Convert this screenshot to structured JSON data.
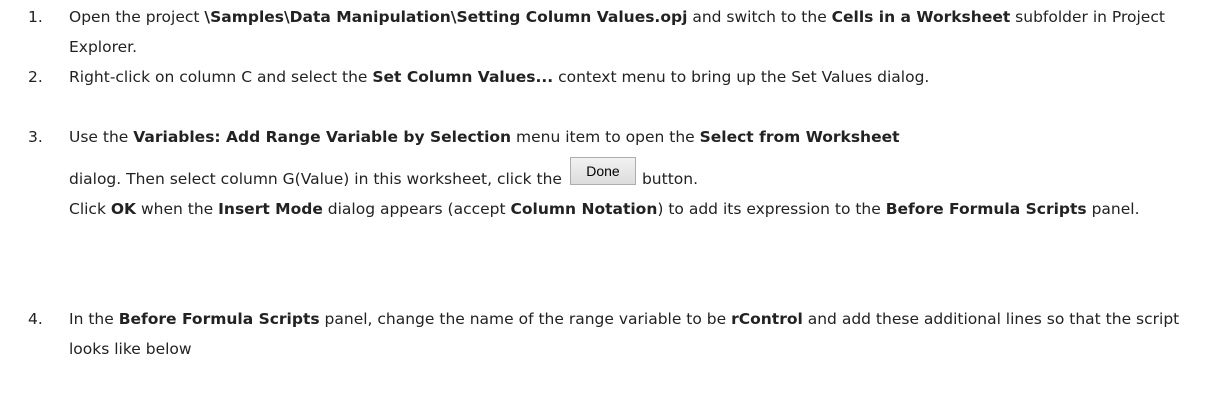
{
  "steps": [
    {
      "num": "1.",
      "parts": [
        {
          "t": "Open the project "
        },
        {
          "t": "\\Samples\\Data Manipulation\\Setting Column Values.opj",
          "b": true
        },
        {
          "t": " and switch to the "
        },
        {
          "t": "Cells in a Worksheet",
          "b": true
        },
        {
          "t": " subfolder in Project Explorer."
        }
      ]
    },
    {
      "num": "2.",
      "parts": [
        {
          "t": "Right-click on column C and select the "
        },
        {
          "t": "Set Column Values...",
          "b": true
        },
        {
          "t": " context menu to bring up the Set Values dialog."
        }
      ]
    },
    {
      "num": "3.",
      "line1": [
        {
          "t": "Use the "
        },
        {
          "t": "Variables: Add Range Variable by Selection",
          "b": true
        },
        {
          "t": " menu item to open the "
        },
        {
          "t": "Select from Worksheet",
          "b": true
        }
      ],
      "line2_before": "dialog. Then select column G(Value) in this worksheet, click the",
      "done_label": "Done",
      "line2_after": "button.",
      "line3": [
        {
          "t": "Click "
        },
        {
          "t": "OK",
          "b": true
        },
        {
          "t": " when the "
        },
        {
          "t": "Insert Mode",
          "b": true
        },
        {
          "t": " dialog appears (accept "
        },
        {
          "t": "Column Notation",
          "b": true
        },
        {
          "t": ") to add its expression to the "
        },
        {
          "t": "Before Formula Scripts",
          "b": true
        },
        {
          "t": " panel."
        }
      ]
    },
    {
      "num": "4.",
      "parts": [
        {
          "t": "In the "
        },
        {
          "t": "Before Formula Scripts",
          "b": true
        },
        {
          "t": " panel, change the name of the range variable to be "
        },
        {
          "t": "rControl",
          "b": true
        },
        {
          "t": " and add these additional lines so that the script looks like below"
        }
      ]
    }
  ]
}
